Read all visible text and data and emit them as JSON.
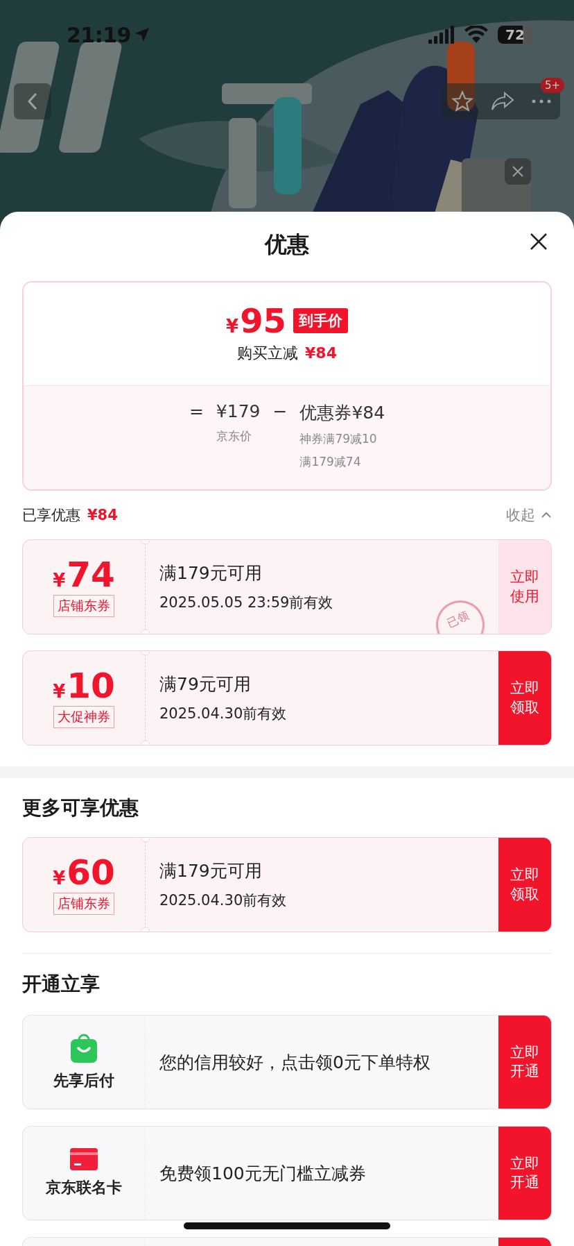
{
  "status_bar": {
    "time": "21:19",
    "battery": "72"
  },
  "nav": {
    "badge": "5+"
  },
  "sheet": {
    "title": "优惠"
  },
  "price_summary": {
    "currency": "¥",
    "final_price": "95",
    "final_tag": "到手价",
    "discount_label": "购买立减",
    "discount_value": "¥84",
    "equals": "=",
    "list_price": "¥179",
    "minus": "−",
    "coupon_total": "优惠券¥84",
    "list_price_label": "京东价",
    "coupon_details": [
      "神券满79减10",
      "满179减74"
    ]
  },
  "enjoyed": {
    "label": "已享优惠",
    "value": "¥84",
    "collapse": "收起"
  },
  "enjoyed_coupons": [
    {
      "currency": "¥",
      "amount": "74",
      "tag": "店铺东券",
      "condition": "满179元可用",
      "expiry": "2025.05.05 23:59前有效",
      "action": "立即使用",
      "claimed": true,
      "stamp": "已领"
    },
    {
      "currency": "¥",
      "amount": "10",
      "tag": "大促神券",
      "condition": "满79元可用",
      "expiry": "2025.04.30前有效",
      "action": "立即领取",
      "claimed": false
    }
  ],
  "more_section": {
    "title": "更多可享优惠",
    "coupons": [
      {
        "currency": "¥",
        "amount": "60",
        "tag": "店铺东券",
        "condition": "满179元可用",
        "expiry": "2025.04.30前有效",
        "action": "立即领取",
        "claimed": false
      }
    ]
  },
  "open_section": {
    "title": "开通立享",
    "offers": [
      {
        "kind": "bag",
        "name": "先享后付",
        "text": "您的信用较好，点击领0元下单特权",
        "action": "立即开通"
      },
      {
        "kind": "card",
        "name": "京东联名卡",
        "text": "免费领100元无门槛立减券",
        "action": "立即开通"
      },
      {
        "kind": "cut"
      }
    ]
  }
}
